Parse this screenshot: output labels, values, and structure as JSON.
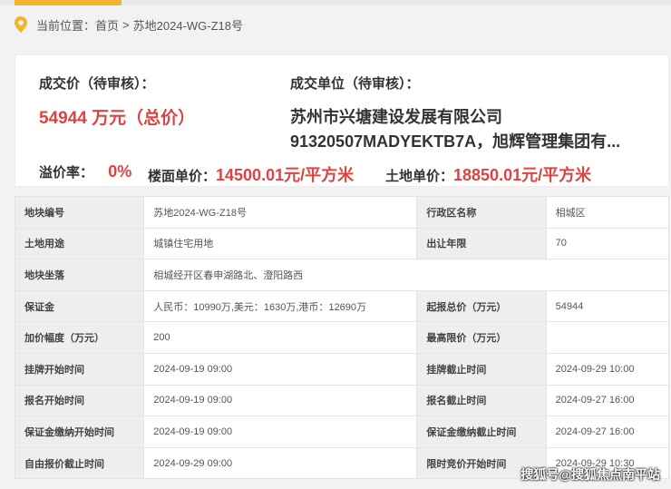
{
  "breadcrumb": {
    "prefix": "当前位置：",
    "home": "首页",
    "separator": ">",
    "current": "苏地2024-WG-Z18号"
  },
  "summary": {
    "price_label": "成交价（待审核）：",
    "price_value": "54944 万元（总价）",
    "buyer_label": "成交单位（待审核）：",
    "buyer_line1": "苏州市兴塘建设发展有限公司",
    "buyer_line2": "91320507MADYEKTB7A，旭辉管理集团有...",
    "premium_label": "溢价率：",
    "premium_value": "0%",
    "floor_price_label": "楼面单价：",
    "floor_price_value": "14500.01元/平方米",
    "land_price_label": "土地单价：",
    "land_price_value": "18850.01元/平方米"
  },
  "details": {
    "rows": [
      {
        "k1": "地块编号",
        "v1": "苏地2024-WG-Z18号",
        "k2": "行政区名称",
        "v2": "相城区"
      },
      {
        "k1": "土地用途",
        "v1": "城镇住宅用地",
        "k2": "出让年限",
        "v2": "70"
      },
      {
        "k1": "地块坐落",
        "v1": "相城经开区春申湖路北、澄阳路西"
      },
      {
        "k1": "保证金",
        "v1": "人民币：10990万,美元：1630万,港币：12690万",
        "k2": "起报总价（万元）",
        "v2": "54944"
      },
      {
        "k1": "加价幅度（万元）",
        "v1": "200",
        "k2": "最高限价（万元）",
        "v2": ""
      },
      {
        "k1": "挂牌开始时间",
        "v1": "2024-09-19 09:00",
        "k2": "挂牌截止时间",
        "v2": "2024-09-29 10:00"
      },
      {
        "k1": "报名开始时间",
        "v1": "2024-09-19 09:00",
        "k2": "报名截止时间",
        "v2": "2024-09-27 16:00"
      },
      {
        "k1": "保证金缴纳开始时间",
        "v1": "2024-09-19 09:00",
        "k2": "保证金缴纳截止时间",
        "v2": "2024-09-27 16:00"
      },
      {
        "k1": "自由报价截止时间",
        "v1": "2024-09-29 09:00",
        "k2": "限时竞价开始时间",
        "v2": "2024-09-29 10:30"
      }
    ]
  },
  "watermark": "搜狐号@搜狐焦点南平站",
  "colors": {
    "accent": "#f0b52a",
    "price": "#e04242"
  }
}
